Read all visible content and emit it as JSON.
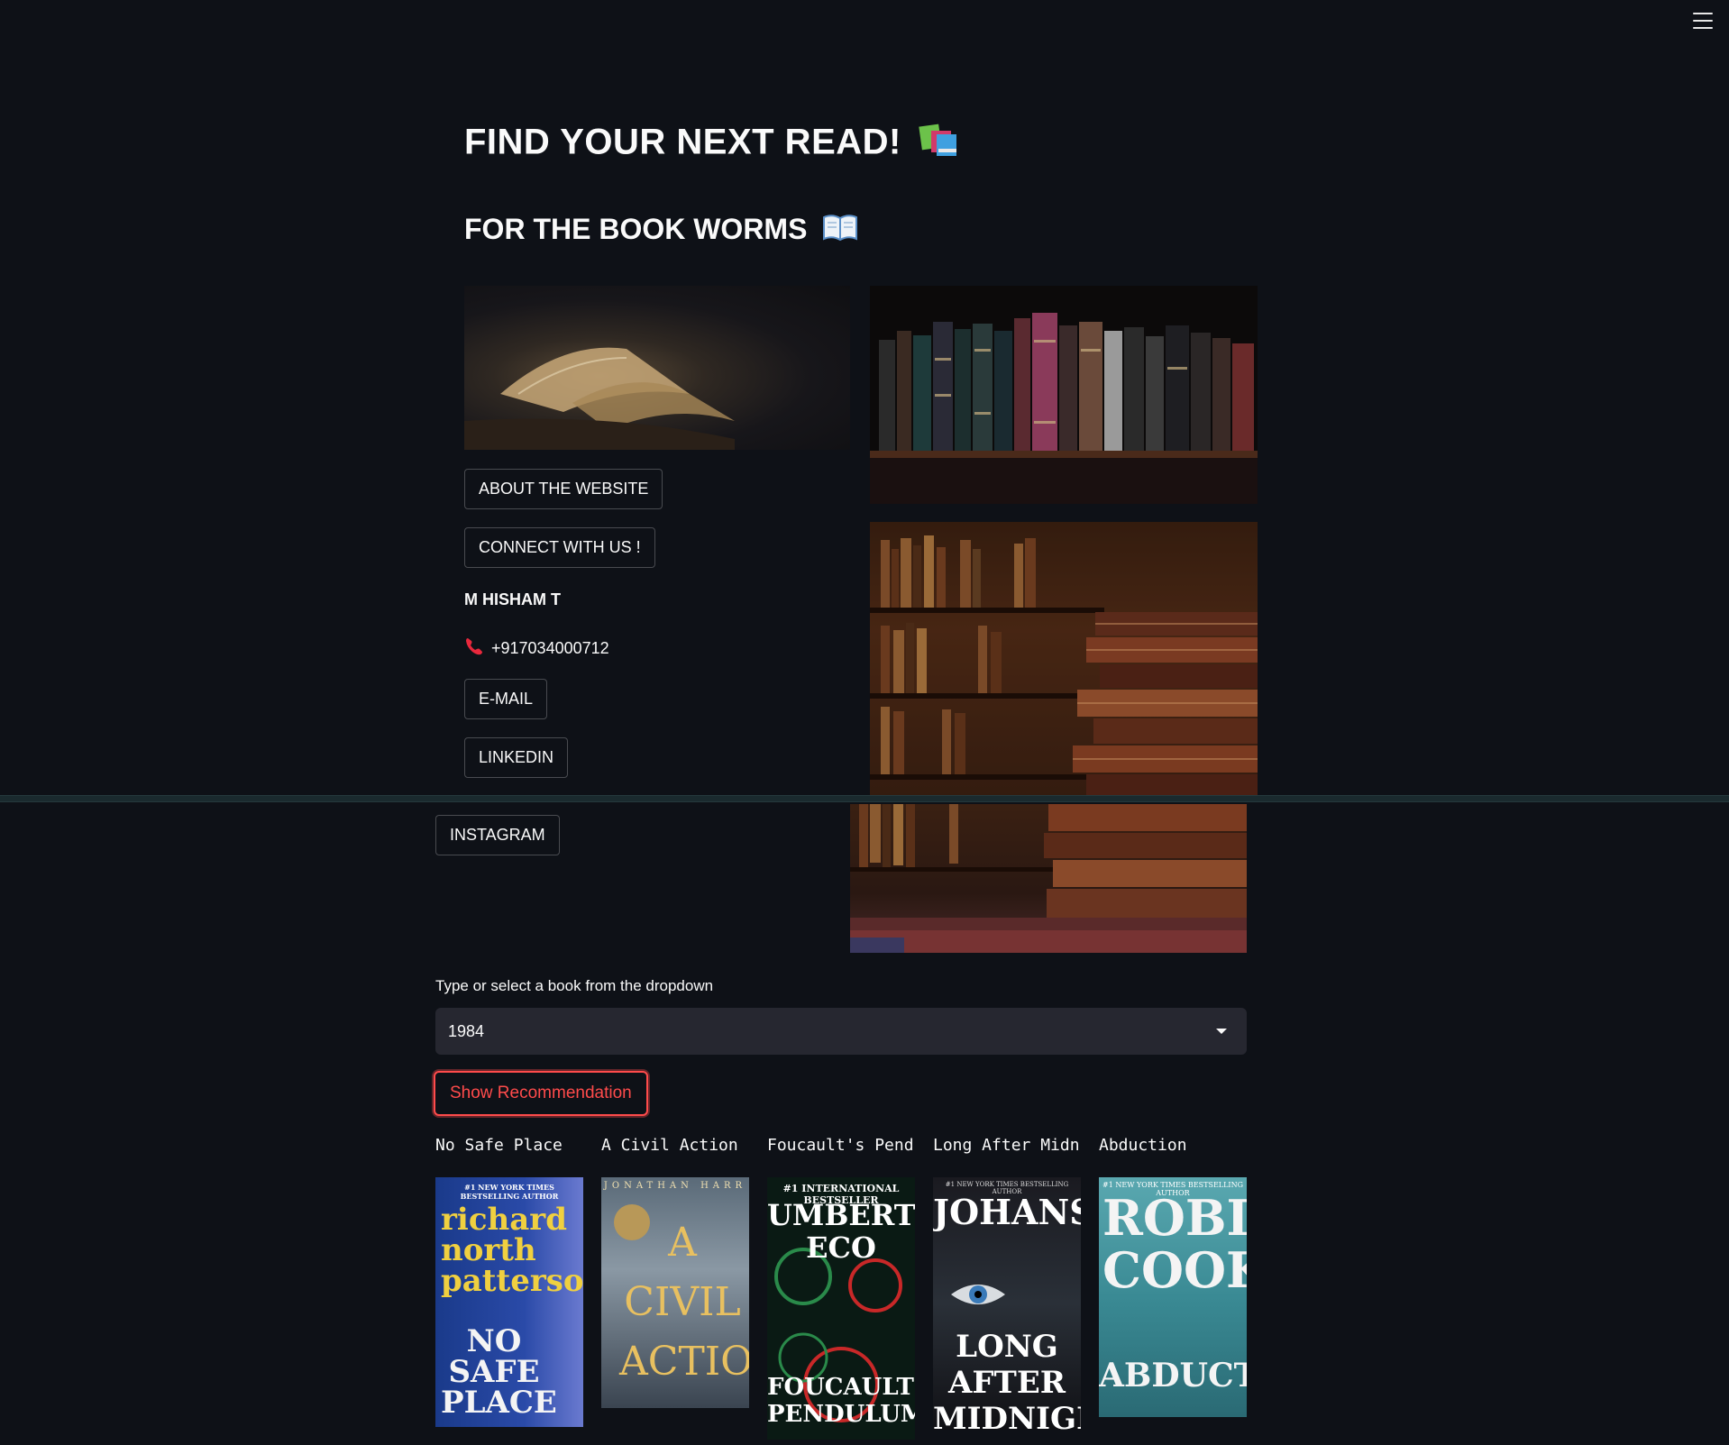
{
  "header": {
    "title": "FIND YOUR NEXT READ!",
    "subtitle": "FOR THE BOOK WORMS"
  },
  "icons": {
    "menu": "hamburger-menu-icon",
    "title_emoji": "books-icon",
    "subtitle_emoji": "open-book-icon",
    "phone": "phone-icon"
  },
  "buttons": {
    "about": "ABOUT THE WEBSITE",
    "connect": "CONNECT WITH US !",
    "email": "E-MAIL",
    "linkedin": "LINKEDIN",
    "instagram": "INSTAGRAM"
  },
  "contact": {
    "name": "M HISHAM T",
    "phone": "+917034000712"
  },
  "select": {
    "label": "Type or select a book from the dropdown",
    "value": "1984"
  },
  "recommend_button": "Show Recommendation",
  "recommendations": [
    {
      "title": "No Safe Place",
      "cover_tag": "#1 NEW YORK TIMES BESTSELLING AUTHOR",
      "cover_author": "richard north patterson",
      "cover_title": "NO SAFE PLACE"
    },
    {
      "title": "A Civil Action",
      "cover_tag": "JONATHAN HARR",
      "cover_author": "",
      "cover_title": "A CIVIL ACTION"
    },
    {
      "title": "Foucault's Pendulum",
      "cover_tag": "#1 INTERNATIONAL BESTSELLER",
      "cover_author": "UMBERTO ECO",
      "cover_title": "FOUCAULT'S PENDULUM"
    },
    {
      "title": "Long After Midnight",
      "cover_tag": "#1 NEW YORK TIMES BESTSELLING AUTHOR",
      "cover_author": "JOHANSEN",
      "cover_title": "LONG AFTER MIDNIGHT"
    },
    {
      "title": "Abduction",
      "cover_tag": "#1 NEW YORK TIMES BESTSELLING AUTHOR",
      "cover_author": "ROBIN COOK",
      "cover_title": "ABDUCTION"
    }
  ],
  "colors": {
    "background": "#0e1117",
    "accent": "#ff4b4b",
    "select_bg": "#262730"
  }
}
